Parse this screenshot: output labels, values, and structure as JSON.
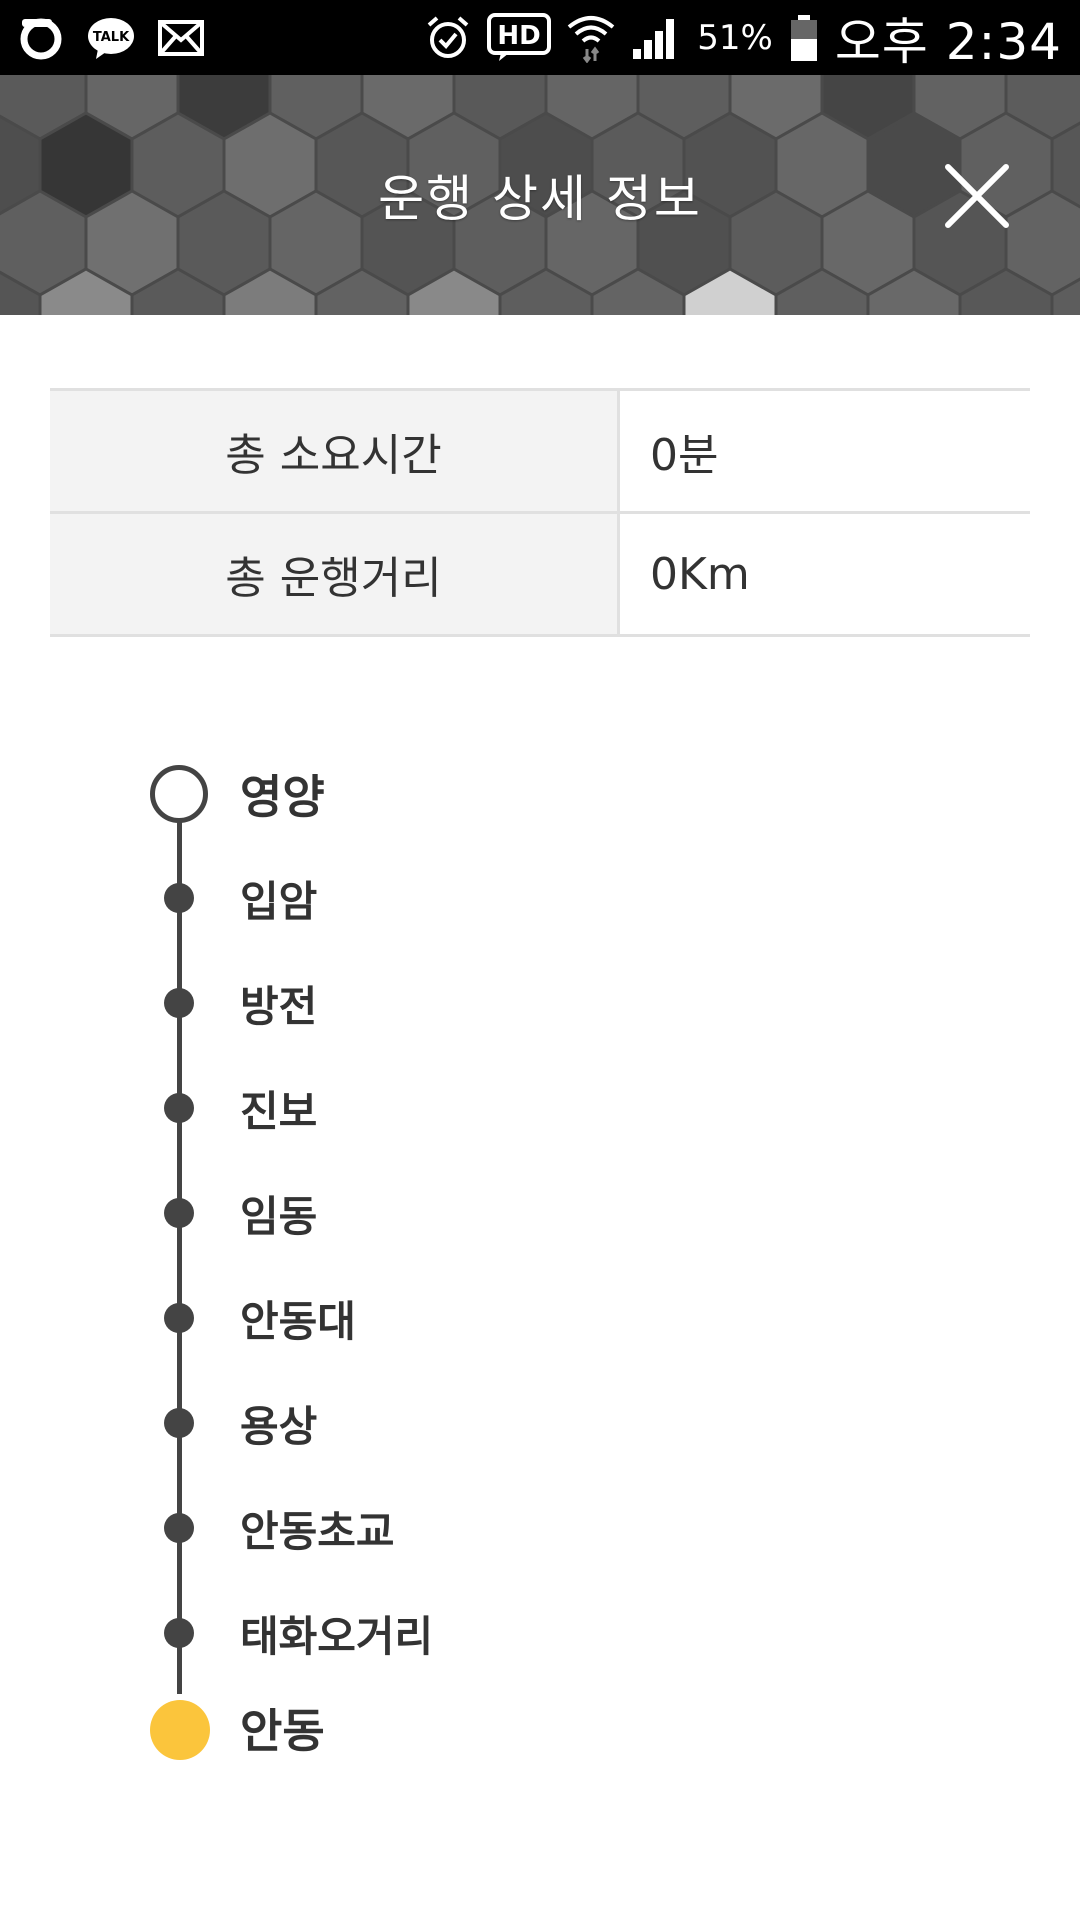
{
  "status_bar": {
    "battery": "51%",
    "time": "오후 2:34",
    "icons": [
      "olleh-icon",
      "kakaotalk-icon",
      "mail-icon",
      "alarm-icon",
      "hd-voice-icon",
      "wifi-icon",
      "signal-icon",
      "battery-icon"
    ],
    "talk_icon_text": "TALK",
    "hd_icon_text": "HD"
  },
  "header": {
    "title": "운행 상세 정보",
    "close_icon": "close-icon"
  },
  "summary": [
    {
      "label": "총 소요시간",
      "value": "0분"
    },
    {
      "label": "총 운행거리",
      "value": "0Km"
    }
  ],
  "route": {
    "stops": [
      {
        "name": "영양",
        "type": "start"
      },
      {
        "name": "입암",
        "type": "middle"
      },
      {
        "name": "방전",
        "type": "middle"
      },
      {
        "name": "진보",
        "type": "middle"
      },
      {
        "name": "임동",
        "type": "middle"
      },
      {
        "name": "안동대",
        "type": "middle"
      },
      {
        "name": "용상",
        "type": "middle"
      },
      {
        "name": "안동초교",
        "type": "middle"
      },
      {
        "name": "태화오거리",
        "type": "middle"
      },
      {
        "name": "안동",
        "type": "end"
      }
    ]
  },
  "colors": {
    "status_bar_bg": "#000000",
    "header_bg": "#555555",
    "timeline": "#444444",
    "end_marker": "#fbc53c",
    "table_label_bg": "#f3f3f3",
    "table_border": "#e0e0e0"
  }
}
